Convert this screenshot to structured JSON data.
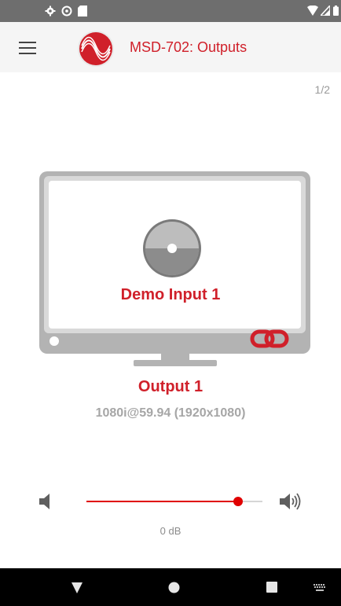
{
  "app": {
    "title": "MSD-702: Outputs",
    "page_indicator": "1/2"
  },
  "colors": {
    "accent": "#d0202a",
    "status_bar": "#6e6e6e",
    "app_bar": "#f5f5f5",
    "monitor_gray": "#b3b3b3",
    "nav_bar": "#000000"
  },
  "status_bar": {
    "left_icons": [
      "settings-icon",
      "do-not-disturb-icon",
      "sd-card-icon"
    ],
    "right_icons": [
      "wifi-icon",
      "cell-signal-icon",
      "battery-icon"
    ]
  },
  "output": {
    "input_name": "Demo Input 1",
    "output_name": "Output 1",
    "resolution": "1080i@59.94 (1920x1080)",
    "source_icon": "disc-icon",
    "linked": true
  },
  "volume": {
    "level_fraction": 0.86,
    "label": "0 dB"
  },
  "nav_bar": {
    "icons": [
      "back-icon",
      "home-icon",
      "recents-icon",
      "keyboard-icon"
    ]
  }
}
